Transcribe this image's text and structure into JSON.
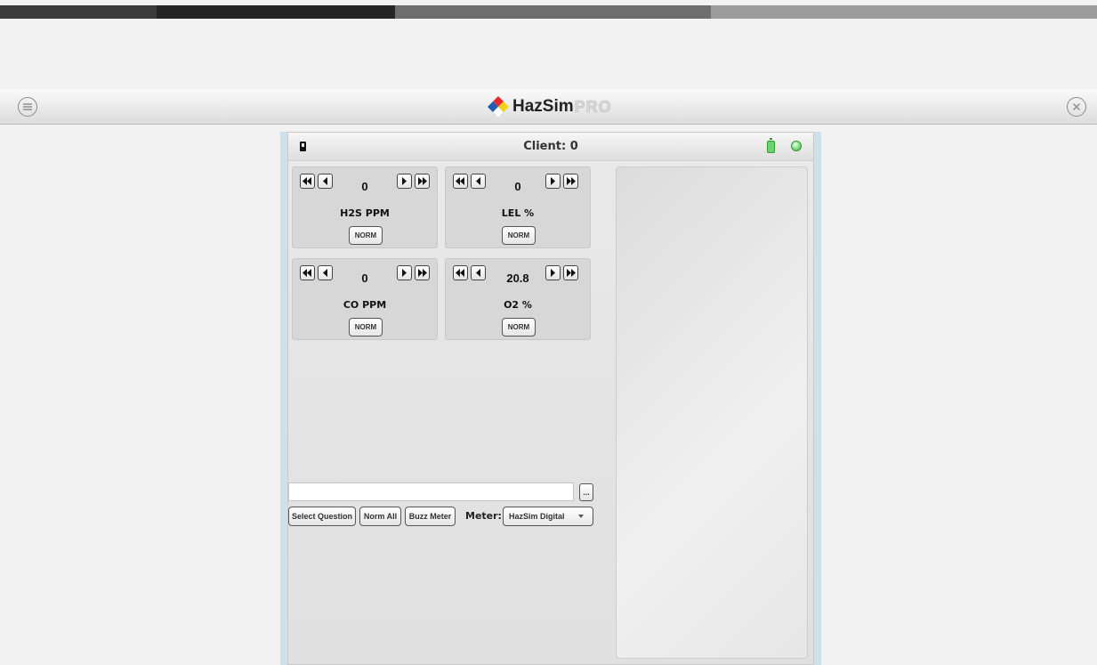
{
  "colors": {
    "stripe": [
      "#3b3b3b",
      "#262626",
      "#6e6e6e",
      "#9c9c9c"
    ],
    "logo_diamond": [
      "#e8262b",
      "#1e5db3",
      "#f3d21a",
      "#ffffff"
    ],
    "battery": "#2aa12a",
    "status_light": "#7ddc7d"
  },
  "titlebar": {
    "menu_icon": "menu-lines-icon",
    "close_icon": "close-circle-icon",
    "logo_text": "HazSim",
    "logo_suffix": "PRO"
  },
  "client": {
    "title": "Client: 0",
    "device_icon": "device-icon",
    "battery_icon": "battery-icon",
    "status_icon": "status-light-icon"
  },
  "sensors": [
    {
      "label": "H2S PPM",
      "value": "0",
      "norm_label": "NORM"
    },
    {
      "label": "LEL %",
      "value": "0",
      "norm_label": "NORM"
    },
    {
      "label": "CO PPM",
      "value": "0",
      "norm_label": "NORM"
    },
    {
      "label": "O2 %",
      "value": "20.8",
      "norm_label": "NORM"
    }
  ],
  "question": {
    "value": "",
    "browse_label": "..."
  },
  "actions": {
    "select_question": "Select Question",
    "norm_all": "Norm All",
    "buzz_meter": "Buzz Meter",
    "meter_label": "Meter:",
    "meter_selected": "HazSim Digital"
  }
}
